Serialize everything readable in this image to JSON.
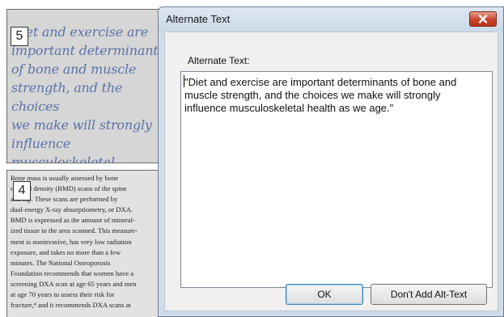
{
  "document": {
    "top_line": "Diet and exercise are",
    "pullquote": "Diet and exercise are\nimportant determinants\nof bone and muscle\nstrength, and the choices\nwe make will strongly\ninfluence musculoskeletal\nhealth as we age.",
    "pullquote_tag": "5",
    "body_text": "Bone mass is usually assessed by bone\nmineral density (BMD) scans of the spine\nand hip. These scans are performed by\ndual-energy X-ray absorptiometry, or DXA.\nBMD is expressed as the amount of mineral-\nized tissue in the area scanned. This measure-\nment is noninvasive, has very low radiation\nexposure, and takes no more than a few\nminutes. The National Osteoporosis\nFoundation recommends that women have a\nscreening DXA scan at age 65 years and men\nat age 70 years to assess their risk for\nfracture,⁴ and it recommends DXA scans at",
    "body_tag": "4"
  },
  "dialog": {
    "title": "Alternate Text",
    "close_icon": "close-x-icon",
    "field_label": "Alternate Text:",
    "field_value": "\"Diet and exercise are important determinants of bone and\nmuscle strength, and the choices we make will strongly\ninfluence musculoskeletal health as we age.\"",
    "ok_label": "OK",
    "no_alt_label": "Don't Add Alt-Text"
  },
  "colors": {
    "dialog_frame": "#cfdcea",
    "close_button": "#c8432a",
    "pullquote_text": "#5a73a8"
  }
}
